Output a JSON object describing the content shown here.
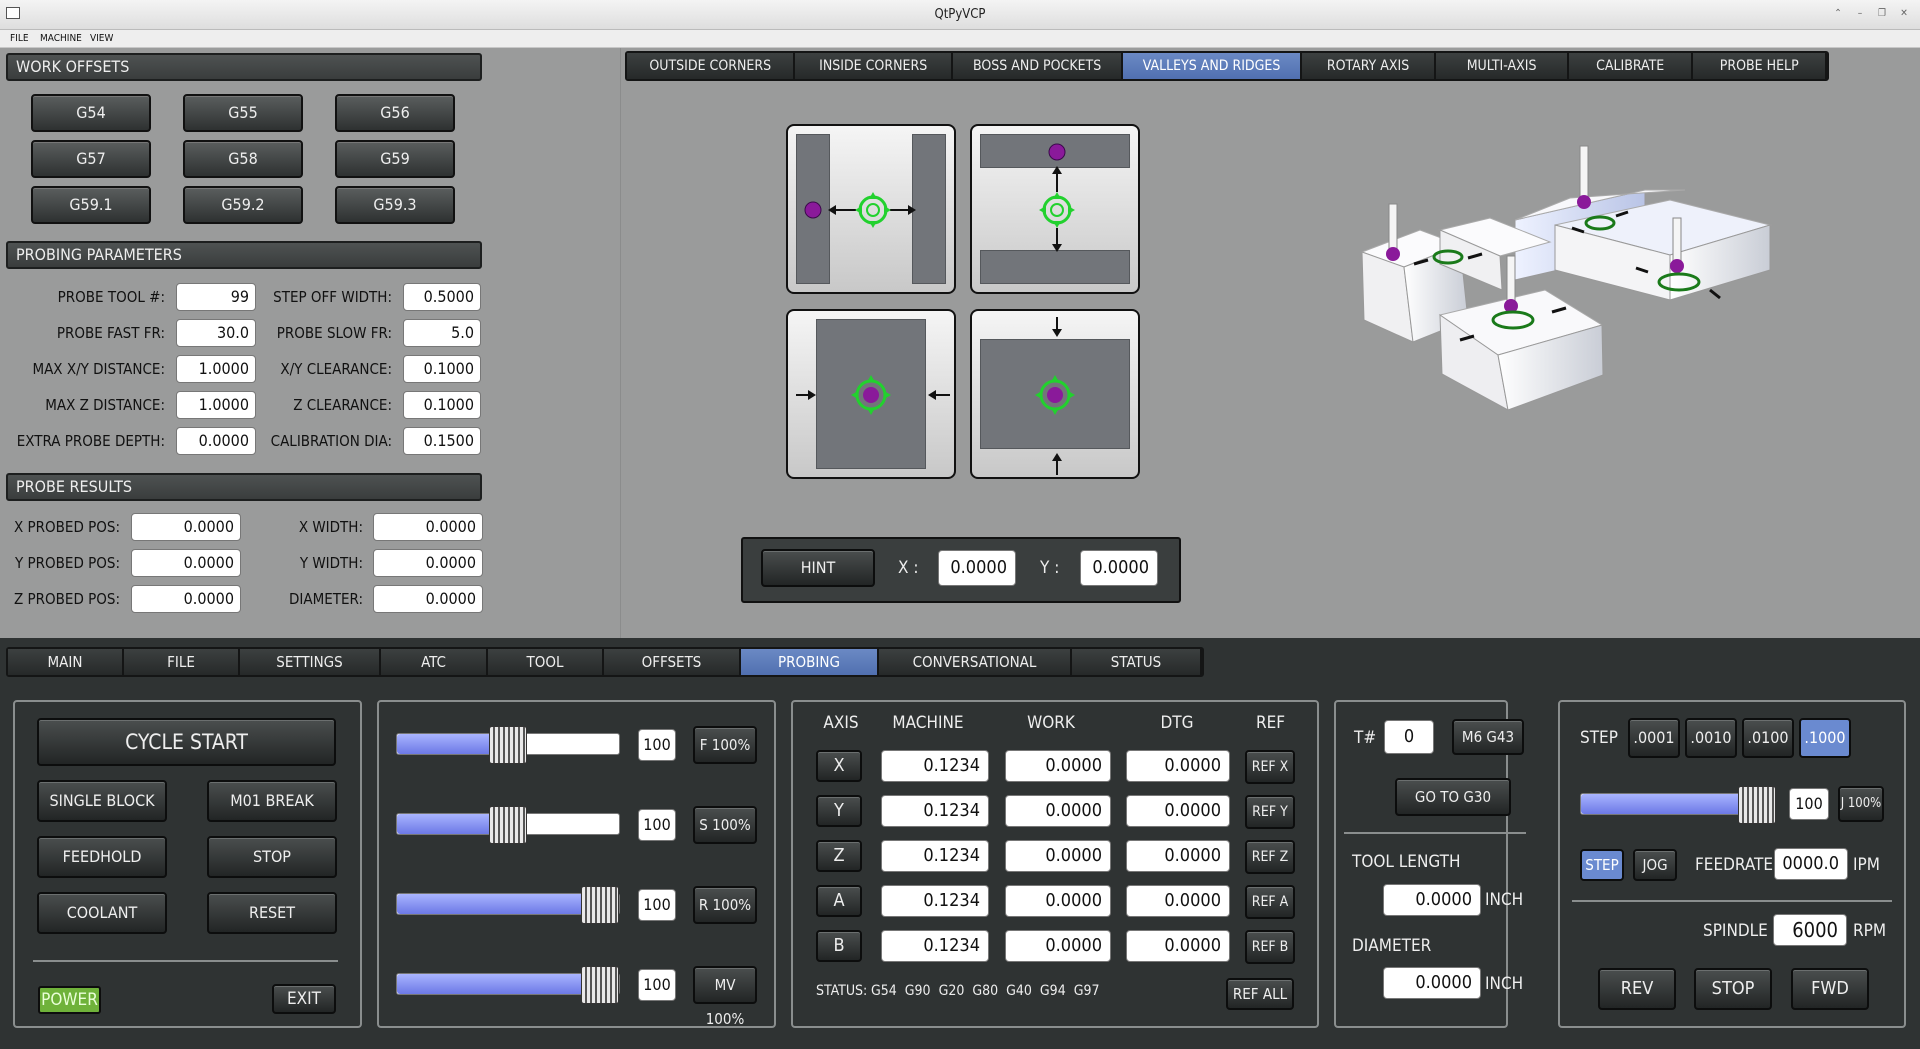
{
  "window": {
    "title": "QtPyVCP"
  },
  "menu": [
    "FILE",
    "MACHINE",
    "VIEW"
  ],
  "work_offsets": {
    "title": "WORK OFFSETS",
    "buttons": [
      "G54",
      "G55",
      "G56",
      "G57",
      "G58",
      "G59",
      "G59.1",
      "G59.2",
      "G59.3"
    ]
  },
  "probing_params": {
    "title": "PROBING PARAMETERS",
    "left": [
      {
        "label": "PROBE TOOL #:",
        "value": "99"
      },
      {
        "label": "PROBE FAST FR:",
        "value": "30.0"
      },
      {
        "label": "MAX X/Y DISTANCE:",
        "value": "1.0000"
      },
      {
        "label": "MAX Z DISTANCE:",
        "value": "1.0000"
      },
      {
        "label": "EXTRA PROBE DEPTH:",
        "value": "0.0000"
      }
    ],
    "right": [
      {
        "label": "STEP OFF WIDTH:",
        "value": "0.5000"
      },
      {
        "label": "PROBE SLOW FR:",
        "value": "5.0"
      },
      {
        "label": "X/Y CLEARANCE:",
        "value": "0.1000"
      },
      {
        "label": "Z CLEARANCE:",
        "value": "0.1000"
      },
      {
        "label": "CALIBRATION DIA:",
        "value": "0.1500"
      }
    ]
  },
  "probe_results": {
    "title": "PROBE RESULTS",
    "left": [
      {
        "label": "X PROBED POS:",
        "value": "0.0000"
      },
      {
        "label": "Y PROBED POS:",
        "value": "0.0000"
      },
      {
        "label": "Z PROBED POS:",
        "value": "0.0000"
      }
    ],
    "right": [
      {
        "label": "X WIDTH:",
        "value": "0.0000"
      },
      {
        "label": "Y WIDTH:",
        "value": "0.0000"
      },
      {
        "label": "DIAMETER:",
        "value": "0.0000"
      }
    ]
  },
  "probe_tabs": [
    "OUTSIDE CORNERS",
    "INSIDE CORNERS",
    "BOSS AND POCKETS",
    "VALLEYS AND RIDGES",
    "ROTARY AXIS",
    "MULTI-AXIS",
    "CALIBRATE",
    "PROBE HELP"
  ],
  "probe_tab_active": "VALLEYS AND RIDGES",
  "hint": {
    "button": "HINT",
    "x_label": "X :",
    "x_value": "0.0000",
    "y_label": "Y :",
    "y_value": "0.0000"
  },
  "main_tabs": [
    "MAIN",
    "FILE",
    "SETTINGS",
    "ATC",
    "TOOL",
    "OFFSETS",
    "PROBING",
    "CONVERSATIONAL",
    "STATUS"
  ],
  "main_tab_active": "PROBING",
  "controls": {
    "cycle_start": "CYCLE START",
    "single_block": "SINGLE BLOCK",
    "m01_break": "M01 BREAK",
    "feedhold": "FEEDHOLD",
    "stop": "STOP",
    "coolant": "COOLANT",
    "reset": "RESET",
    "power": "POWER",
    "exit": "EXIT"
  },
  "overrides": [
    {
      "value": "100",
      "button": "F 100%",
      "level": 0.5
    },
    {
      "value": "100",
      "button": "S 100%",
      "level": 0.5
    },
    {
      "value": "100",
      "button": "R 100%",
      "level": 1.0
    },
    {
      "value": "100",
      "button": "MV 100%",
      "level": 1.0
    }
  ],
  "dro": {
    "headers": [
      "AXIS",
      "MACHINE",
      "WORK",
      "DTG",
      "REF"
    ],
    "rows": [
      {
        "axis": "X",
        "machine": "0.1234",
        "work": "0.0000",
        "dtg": "0.0000",
        "ref": "REF X"
      },
      {
        "axis": "Y",
        "machine": "0.1234",
        "work": "0.0000",
        "dtg": "0.0000",
        "ref": "REF Y"
      },
      {
        "axis": "Z",
        "machine": "0.1234",
        "work": "0.0000",
        "dtg": "0.0000",
        "ref": "REF Z"
      },
      {
        "axis": "A",
        "machine": "0.1234",
        "work": "0.0000",
        "dtg": "0.0000",
        "ref": "REF A"
      },
      {
        "axis": "B",
        "machine": "0.1234",
        "work": "0.0000",
        "dtg": "0.0000",
        "ref": "REF B"
      }
    ],
    "status_label": "STATUS:",
    "status_codes": "G54  G90  G20  G80  G40  G94  G97",
    "ref_all": "REF ALL"
  },
  "tool": {
    "t_label": "T#",
    "t_value": "0",
    "m6": "M6 G43",
    "goto": "GO TO G30",
    "length_label": "TOOL LENGTH",
    "length_value": "0.0000",
    "length_unit": "INCH",
    "dia_label": "DIAMETER",
    "dia_value": "0.0000",
    "dia_unit": "INCH"
  },
  "jog": {
    "step_label": "STEP",
    "steps": [
      ".0001",
      ".0010",
      ".0100",
      ".1000"
    ],
    "step_active": ".1000",
    "jog_value": "100",
    "jog_button": "J 100%",
    "jog_level": 0.9,
    "mode_step": "STEP",
    "mode_jog": "JOG",
    "feedrate_label": "FEEDRATE",
    "feedrate_value": "0000.0",
    "feedrate_unit": "IPM",
    "spindle_label": "SPINDLE",
    "spindle_value": "6000",
    "spindle_unit": "RPM",
    "rev": "REV",
    "stop": "STOP",
    "fwd": "FWD"
  },
  "colors": {
    "active_tab": "#5a78b8",
    "power": "#6fb23a",
    "slider_fill": "#8b96f2",
    "target_green": "#22d12e",
    "probe_ball": "#8a1a9a"
  }
}
